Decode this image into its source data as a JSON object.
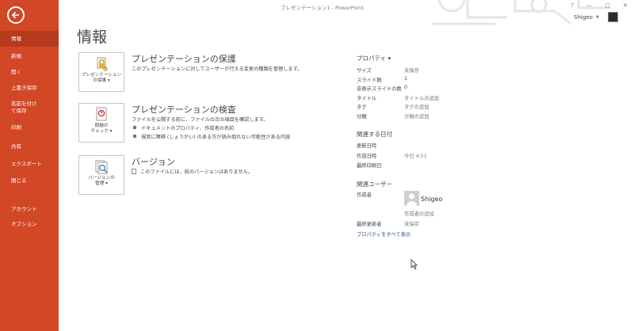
{
  "window": {
    "title": "プレゼンテーション1 - PowerPoint",
    "controls": [
      "?",
      "—",
      "□",
      "✕"
    ],
    "user": "Shigeo"
  },
  "sidebar": {
    "items": [
      {
        "label": "情報",
        "active": true
      },
      {
        "label": "新規"
      },
      {
        "label": "開く"
      },
      {
        "label": "上書き保存"
      },
      {
        "label": "名前を付けて保存"
      },
      {
        "label": "印刷"
      },
      {
        "label": "共有"
      },
      {
        "label": "エクスポート"
      },
      {
        "label": "閉じる"
      },
      {
        "label": "アカウント"
      },
      {
        "label": "オプション"
      }
    ]
  },
  "page": {
    "title": "情報"
  },
  "protect": {
    "btn_line1": "プレゼンテーション",
    "btn_line2": "の保護 ▾",
    "heading": "プレゼンテーションの保護",
    "desc": "このプレゼンテーションに対してユーザーが行える変更の種類を管理します。"
  },
  "inspect": {
    "btn_line1": "問題の",
    "btn_line2": "チェック ▾",
    "heading": "プレゼンテーションの検査",
    "desc": "ファイルを公開する前に、ファイルの次の項目を確認します。",
    "bullets": [
      "ドキュメントのプロパティ、作成者の名前",
      "視覚に障碍 (しょうがい) のある方が読み取れない可能性がある内容"
    ]
  },
  "versions": {
    "btn_line1": "バージョンの",
    "btn_line2": "管理 ▾",
    "heading": "バージョン",
    "desc": "このファイルには、前のバージョンはありません。"
  },
  "properties": {
    "heading": "プロパティ ▾",
    "rows": [
      {
        "label": "サイズ",
        "value": "未保存"
      },
      {
        "label": "スライド数",
        "value": "1"
      },
      {
        "label": "非表示スライドの数",
        "value": "0"
      },
      {
        "label": "タイトル",
        "value": "タイトルの追加"
      },
      {
        "label": "タグ",
        "value": "タグの追加"
      },
      {
        "label": "分類",
        "value": "分類の追加"
      }
    ]
  },
  "dates": {
    "heading": "関連する日付",
    "rows": [
      {
        "label": "更新日時",
        "value": ""
      },
      {
        "label": "作成日時",
        "value": "今日 4:51"
      },
      {
        "label": "最終印刷日",
        "value": ""
      }
    ]
  },
  "people": {
    "heading": "関連ユーザー",
    "author_label": "作成者",
    "author_name": "Shigeo",
    "add_author": "作成者の追加",
    "last_modified_label": "最終更新者",
    "last_modified_value": "未保存",
    "show_all": "プロパティをすべて表示"
  }
}
